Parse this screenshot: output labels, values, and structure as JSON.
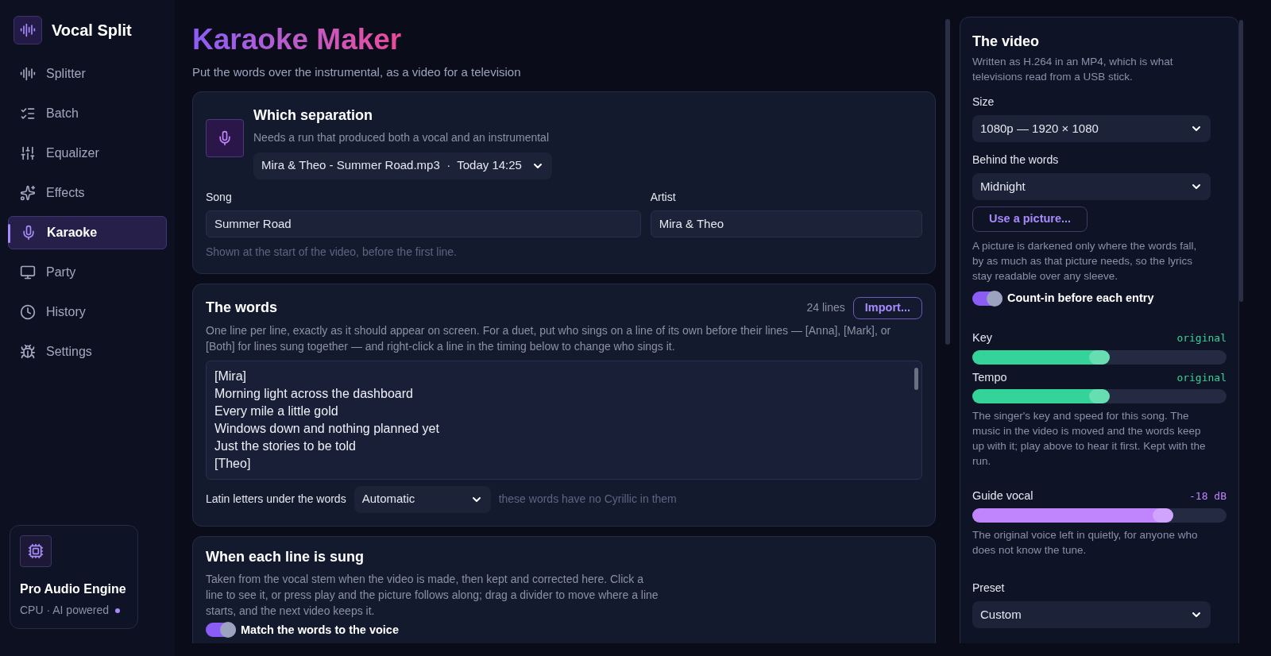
{
  "app": {
    "name": "Vocal Split"
  },
  "sidebar": {
    "items": [
      {
        "label": "Splitter",
        "selected": false
      },
      {
        "label": "Batch",
        "selected": false
      },
      {
        "label": "Equalizer",
        "selected": false
      },
      {
        "label": "Effects",
        "selected": false
      },
      {
        "label": "Karaoke",
        "selected": true
      },
      {
        "label": "Party",
        "selected": false
      },
      {
        "label": "History",
        "selected": false
      },
      {
        "label": "Settings",
        "selected": false
      }
    ],
    "engine": {
      "title": "Pro Audio Engine",
      "subtitle": "CPU · AI powered",
      "color": "#a78bfa"
    }
  },
  "page": {
    "title": "Karaoke Maker",
    "subtitle": "Put the words over the instrumental, as a video for a television"
  },
  "separation": {
    "title": "Which separation",
    "hint": "Needs a run that produced both a vocal and an instrumental",
    "run": "Mira & Theo - Summer Road.mp3  ·  Today 14:25",
    "song": {
      "label": "Song",
      "value": "Summer Road"
    },
    "artist": {
      "label": "Artist",
      "value": "Mira & Theo"
    },
    "note": "Shown at the start of the video, before the first line."
  },
  "words": {
    "title": "The words",
    "count": "24 lines",
    "import": "Import...",
    "hint": "One line per line, exactly as it should appear on screen. For a duet, put who sings on a line of its own before their lines — [Anna], [Mark], or [Both] for lines sung together — and right-click a line in the timing below to change who sings it.",
    "lines": [
      "[Mira]",
      "Morning light across the dashboard",
      "Every mile a little gold",
      "Windows down and nothing planned yet",
      "Just the stories to be told",
      "[Theo]"
    ],
    "latin": {
      "label": "Latin letters under the words",
      "value": "Automatic",
      "note": "these words have no Cyrillic in them"
    }
  },
  "timing": {
    "title": "When each line is sung",
    "hint": "Taken from the vocal stem when the video is made, then kept and corrected here. Click a line to see it, or press play and the picture follows along; drag a divider to move where a line starts, and the next video keeps it.",
    "match": {
      "label": "Match the words to the voice",
      "on": true
    }
  },
  "video": {
    "title": "The video",
    "hint": "Written as H.264 in an MP4, which is what televisions read from a USB stick.",
    "size": {
      "label": "Size",
      "value": "1080p — 1920 × 1080"
    },
    "behind": {
      "label": "Behind the words",
      "value": "Midnight"
    },
    "picture_button": "Use a picture...",
    "picture_note": "A picture is darkened only where the words fall, by as much as that picture needs, so the lyrics stay readable over any sleeve.",
    "count_in": {
      "label": "Count-in before each entry",
      "on": true
    },
    "sliders": [
      {
        "label": "Key",
        "reading": "original",
        "level": 0.54,
        "color": "#34d399"
      },
      {
        "label": "Tempo",
        "reading": "original",
        "level": 0.54,
        "color": "#34d399"
      }
    ],
    "sliders_note": "The singer's key and speed for this song. The music in the video is moved and the words keep up with it; play above to hear it first. Kept with the run.",
    "guide": {
      "label": "Guide vocal",
      "reading": "-18 dB",
      "level": 0.79,
      "color": "#c084fc"
    },
    "guide_note": "The original voice left in quietly, for anyone who does not know the tune.",
    "preset": {
      "label": "Preset",
      "value": "Custom"
    }
  }
}
